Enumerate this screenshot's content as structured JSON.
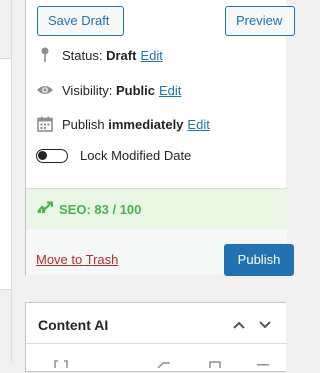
{
  "buttons": {
    "save_draft": "Save Draft",
    "preview": "Preview",
    "publish": "Publish"
  },
  "status": {
    "label": "Status:",
    "value": "Draft",
    "edit": "Edit"
  },
  "visibility": {
    "label": "Visibility:",
    "value": "Public",
    "edit": "Edit"
  },
  "publish_time": {
    "label": "Publish",
    "value": "immediately",
    "edit": "Edit"
  },
  "lock_modified": {
    "label": "Lock Modified Date",
    "enabled": false
  },
  "seo": {
    "label": "SEO: 83 / 100",
    "score": 83,
    "max": 100,
    "color": "#46b450"
  },
  "trash_link": "Move to Trash",
  "content_ai": {
    "title": "Content AI"
  },
  "colors": {
    "accent": "#2271b1",
    "danger": "#b32d2e",
    "seo_bg": "#e8f6e3"
  }
}
